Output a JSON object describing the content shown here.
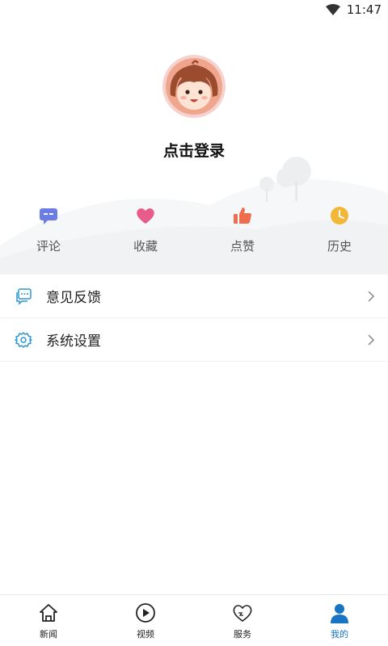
{
  "status_bar": {
    "time": "11:47"
  },
  "header": {
    "login_text": "点击登录"
  },
  "quick_actions": [
    {
      "label": "评论",
      "icon": "comment-icon",
      "color": "#6b7de4"
    },
    {
      "label": "收藏",
      "icon": "heart-icon",
      "color": "#e85c8a"
    },
    {
      "label": "点赞",
      "icon": "thumbs-up-icon",
      "color": "#ee6d4f"
    },
    {
      "label": "历史",
      "icon": "clock-icon",
      "color": "#f2b736"
    }
  ],
  "menu": [
    {
      "label": "意见反馈",
      "icon": "feedback-icon"
    },
    {
      "label": "系统设置",
      "icon": "settings-icon"
    }
  ],
  "bottom_nav": [
    {
      "label": "新闻",
      "icon": "home-icon"
    },
    {
      "label": "视频",
      "icon": "play-icon"
    },
    {
      "label": "服务",
      "icon": "heart-outline-icon"
    },
    {
      "label": "我的",
      "icon": "user-icon",
      "active": true
    }
  ],
  "colors": {
    "accent": "#1a74c4",
    "menu_icon": "#2d96d6"
  }
}
